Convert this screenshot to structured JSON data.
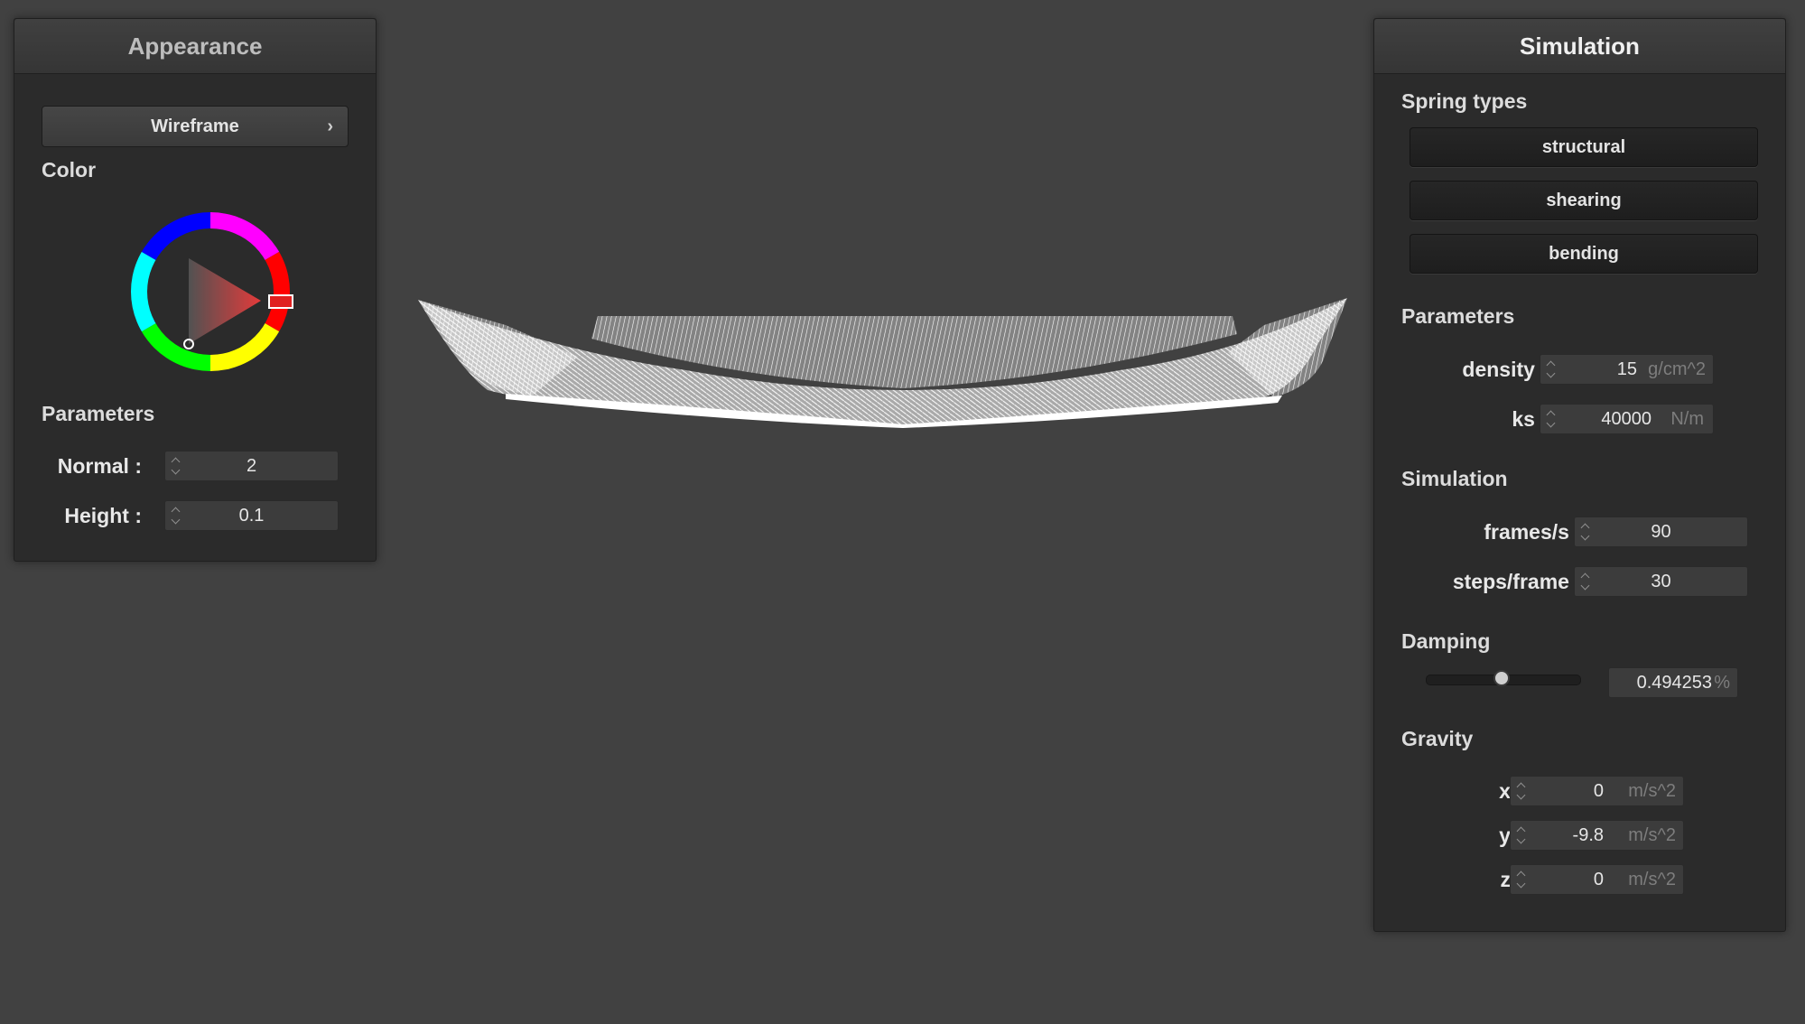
{
  "appearance": {
    "title": "Appearance",
    "mode_button": "Wireframe",
    "color_label": "Color",
    "selected_color": "#e02020",
    "parameters_label": "Parameters",
    "normal": {
      "label": "Normal :",
      "value": "2"
    },
    "height": {
      "label": "Height :",
      "value": "0.1"
    }
  },
  "simulation": {
    "title": "Simulation",
    "spring_types_label": "Spring types",
    "spring_buttons": [
      "structural",
      "shearing",
      "bending"
    ],
    "parameters_label": "Parameters",
    "density": {
      "label": "density :",
      "value": "15",
      "unit": "g/cm^2"
    },
    "ks": {
      "label": "ks :",
      "value": "40000",
      "unit": "N/m"
    },
    "simulation_label": "Simulation",
    "fps": {
      "label": "frames/s :",
      "value": "90"
    },
    "steps": {
      "label": "steps/frame :",
      "value": "30"
    },
    "damping_label": "Damping",
    "damping": {
      "value": "0.494253",
      "unit": "%",
      "slider_fraction": 0.49
    },
    "gravity_label": "Gravity",
    "gravity": [
      {
        "label": "x :",
        "value": "0",
        "unit": "m/s^2"
      },
      {
        "label": "y :",
        "value": "-9.8",
        "unit": "m/s^2"
      },
      {
        "label": "z :",
        "value": "0",
        "unit": "m/s^2"
      }
    ]
  },
  "viewport": {
    "cloth_color": "#ffffff",
    "background": "#414141"
  }
}
